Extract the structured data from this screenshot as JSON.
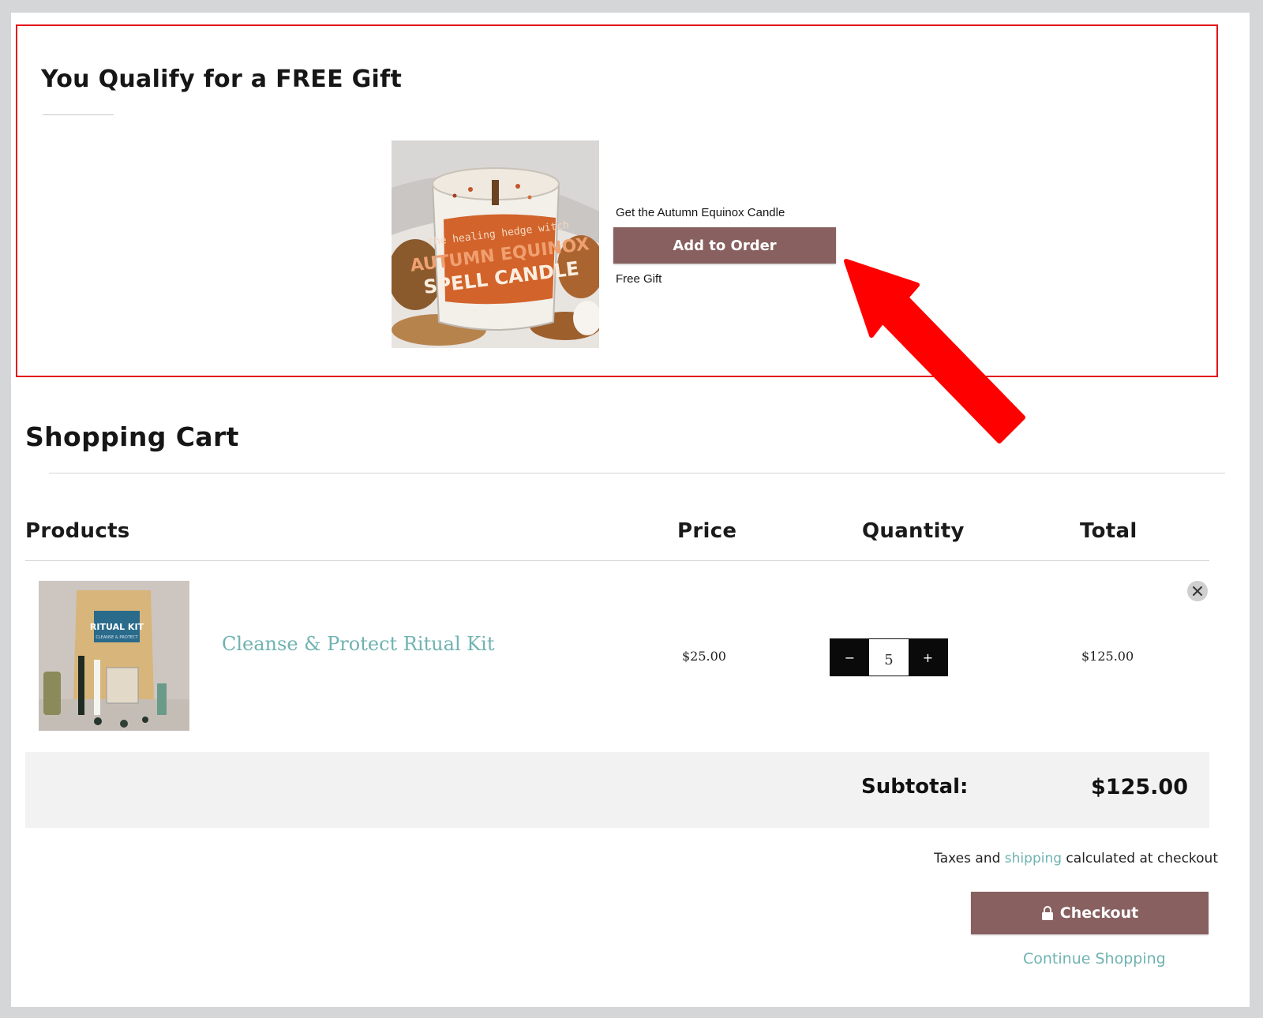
{
  "gift_offer": {
    "title": "You Qualify for a FREE Gift",
    "offer_text": "Get the Autumn Equinox Candle",
    "add_button_label": "Add to Order",
    "free_gift_label": "Free Gift",
    "product_image": {
      "label_line1": "the healing hedge witch",
      "label_line2": "AUTUMN EQUINOX",
      "label_line3": "SPELL CANDLE"
    }
  },
  "cart": {
    "title": "Shopping Cart",
    "columns": {
      "products": "Products",
      "price": "Price",
      "quantity": "Quantity",
      "total": "Total"
    },
    "items": [
      {
        "name": "Cleanse & Protect Ritual Kit",
        "price": "$25.00",
        "quantity": "5",
        "total": "$125.00",
        "image_label_line1": "RITUAL KIT",
        "image_label_line2": "CLEANSE & PROTECT"
      }
    ],
    "qty_decrement": "−",
    "qty_increment": "+",
    "subtotal_label": "Subtotal:",
    "subtotal_value": "$125.00",
    "tax_note_before": "Taxes and ",
    "tax_note_link": "shipping",
    "tax_note_after": " calculated at checkout",
    "checkout_label": "Checkout",
    "continue_label": "Continue Shopping"
  },
  "colors": {
    "accent_button": "#87605f",
    "link_teal": "#6fb3b1",
    "highlight_red": "#e3141b"
  },
  "icons": [
    "lock-icon",
    "close-icon",
    "red-arrow-annotation"
  ]
}
